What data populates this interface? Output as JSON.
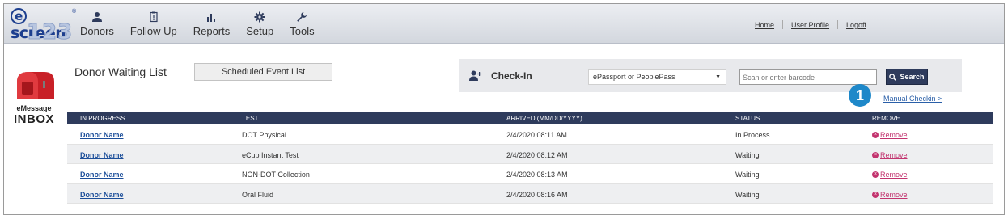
{
  "logo": {
    "word": "screen",
    "e": "e",
    "number": "123",
    "reg": "®"
  },
  "nav": [
    {
      "label": "Donors",
      "icon": "person-icon"
    },
    {
      "label": "Follow Up",
      "icon": "clipboard-icon"
    },
    {
      "label": "Reports",
      "icon": "bar-chart-icon"
    },
    {
      "label": "Setup",
      "icon": "gear-icon"
    },
    {
      "label": "Tools",
      "icon": "wrench-icon"
    }
  ],
  "toplinks": {
    "home": "Home",
    "profile": "User Profile",
    "logoff": "Logoff"
  },
  "inbox": {
    "line1": "eMessage",
    "line2": "INBOX",
    "icon": "mailbox-icon"
  },
  "page_title": "Donor Waiting List",
  "scheduled_button": "Scheduled Event List",
  "checkin": {
    "label": "Check-In",
    "icon": "add-person-icon",
    "select_value": "ePassport or PeoplePass",
    "caret": "▼",
    "barcode_placeholder": "Scan or enter barcode",
    "search_label": "Search"
  },
  "badge": "1",
  "manual_checkin": "Manual Checkin >",
  "table": {
    "headers": [
      "IN PROGRESS",
      "TEST",
      "ARRIVED (MM/DD/YYYY)",
      "STATUS",
      "REMOVE"
    ],
    "rows": [
      {
        "donor": "Donor Name",
        "test": "DOT Physical",
        "arrived": "2/4/2020 08:11 AM",
        "status": "In Process",
        "remove": "Remove"
      },
      {
        "donor": "Donor Name",
        "test": "eCup Instant Test",
        "arrived": "2/4/2020 08:12 AM",
        "status": "Waiting",
        "remove": "Remove"
      },
      {
        "donor": "Donor Name",
        "test": "NON-DOT Collection",
        "arrived": "2/4/2020 08:13 AM",
        "status": "Waiting",
        "remove": "Remove"
      },
      {
        "donor": "Donor Name",
        "test": "Oral Fluid",
        "arrived": "2/4/2020 08:16 AM",
        "status": "Waiting",
        "remove": "Remove"
      }
    ]
  },
  "colors": {
    "header": "#2e3b5c",
    "link": "#1d4f9a",
    "remove": "#c2336e",
    "badge": "#1e88c9"
  }
}
